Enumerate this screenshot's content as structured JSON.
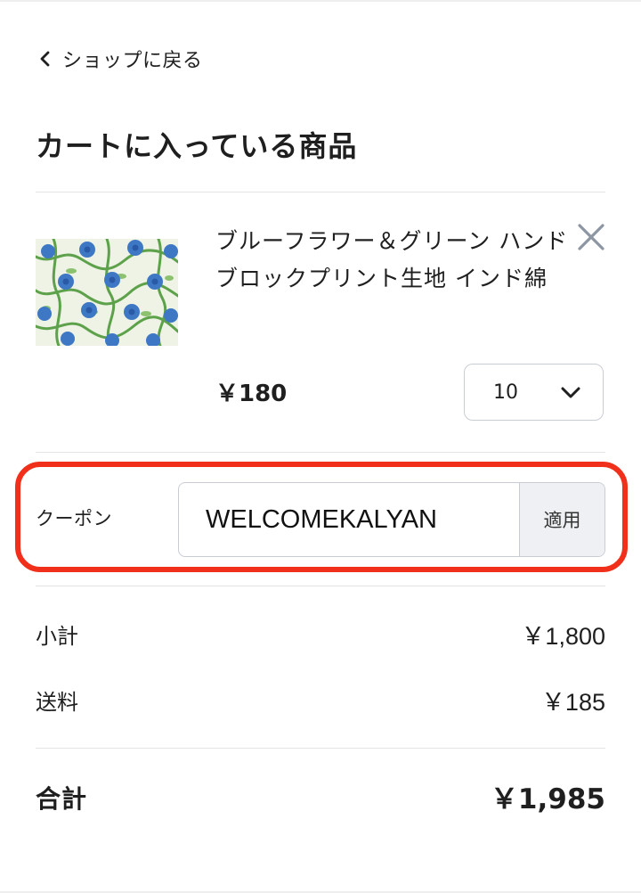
{
  "nav": {
    "back_label": "ショップに戻る"
  },
  "page": {
    "title": "カートに入っている商品"
  },
  "cart": {
    "items": [
      {
        "name": "ブルーフラワー＆グリーン ハンドブロックプリント生地 インド綿",
        "price": "￥180",
        "quantity": "10",
        "thumbnail_icon": "fabric-swatch-image",
        "remove_icon": "close-icon"
      }
    ]
  },
  "coupon": {
    "label": "クーポン",
    "value": "WELCOMEKALYAN",
    "apply_label": "適用",
    "highlight_color": "#f0301a"
  },
  "summary": {
    "subtotal_label": "小計",
    "subtotal_value": "￥1,800",
    "shipping_label": "送料",
    "shipping_value": "￥185",
    "total_label": "合計",
    "total_value": "￥1,985"
  }
}
